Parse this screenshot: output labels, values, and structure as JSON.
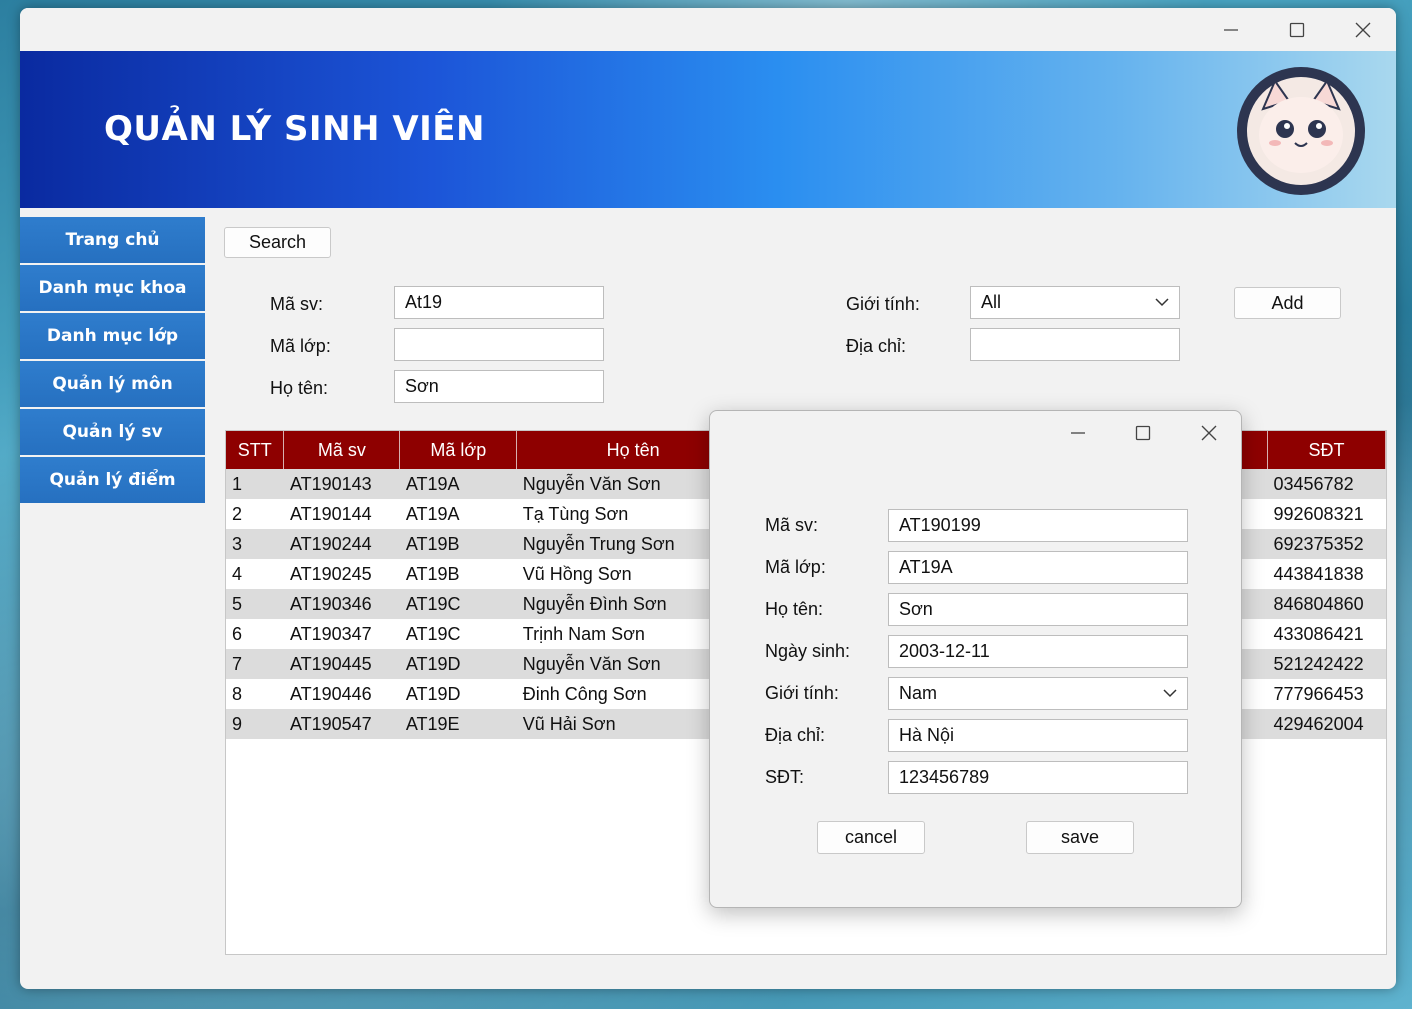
{
  "window": {
    "controls": [
      "minimize-icon",
      "maximize-icon",
      "close-icon"
    ]
  },
  "banner": {
    "title": "QUẢN LÝ SINH VIÊN"
  },
  "sidebar": {
    "items": [
      {
        "label": "Trang chủ"
      },
      {
        "label": "Danh mục khoa"
      },
      {
        "label": "Danh mục lớp"
      },
      {
        "label": "Quản lý môn"
      },
      {
        "label": "Quản lý sv"
      },
      {
        "label": "Quản lý điểm"
      }
    ]
  },
  "search": {
    "button_label": "Search",
    "add_label": "Add",
    "ma_sv_label": "Mã sv:",
    "ma_sv_value": "At19",
    "ma_lop_label": "Mã lớp:",
    "ma_lop_value": "",
    "ho_ten_label": "Họ tên:",
    "ho_ten_value": "Sơn",
    "gioi_tinh_label": "Giới tính:",
    "gioi_tinh_value": "All",
    "dia_chi_label": "Địa chỉ:",
    "dia_chi_value": ""
  },
  "table": {
    "columns": [
      "STT",
      "Mã sv",
      "Mã lớp",
      "Họ tên",
      "SĐT"
    ],
    "rows": [
      [
        "1",
        "AT190143",
        "AT19A",
        "Nguyễn Văn Sơn",
        "03456782"
      ],
      [
        "2",
        "AT190144",
        "AT19A",
        "Tạ Tùng Sơn",
        "992608321"
      ],
      [
        "3",
        "AT190244",
        "AT19B",
        "Nguyễn Trung Sơn",
        "692375352"
      ],
      [
        "4",
        "AT190245",
        "AT19B",
        "Vũ Hồng Sơn",
        "443841838"
      ],
      [
        "5",
        "AT190346",
        "AT19C",
        "Nguyễn Đình Sơn",
        "846804860"
      ],
      [
        "6",
        "AT190347",
        "AT19C",
        "Trịnh Nam Sơn",
        "433086421"
      ],
      [
        "7",
        "AT190445",
        "AT19D",
        "Nguyễn Văn Sơn",
        "521242422"
      ],
      [
        "8",
        "AT190446",
        "AT19D",
        "Đinh Công Sơn",
        "777966453"
      ],
      [
        "9",
        "AT190547",
        "AT19E",
        "Vũ Hải Sơn",
        "429462004"
      ]
    ]
  },
  "dialog": {
    "fields": [
      {
        "label": "Mã sv:",
        "value": "AT190199"
      },
      {
        "label": "Mã lớp:",
        "value": "AT19A"
      },
      {
        "label": "Họ tên:",
        "value": "Sơn"
      },
      {
        "label": "Ngày sinh:",
        "value": "2003-12-11"
      },
      {
        "label": "Giới tính:",
        "value": "Nam"
      },
      {
        "label": "Địa chỉ:",
        "value": "Hà Nội"
      },
      {
        "label": "SĐT:",
        "value": "123456789"
      }
    ],
    "cancel_label": "cancel",
    "save_label": "save"
  }
}
